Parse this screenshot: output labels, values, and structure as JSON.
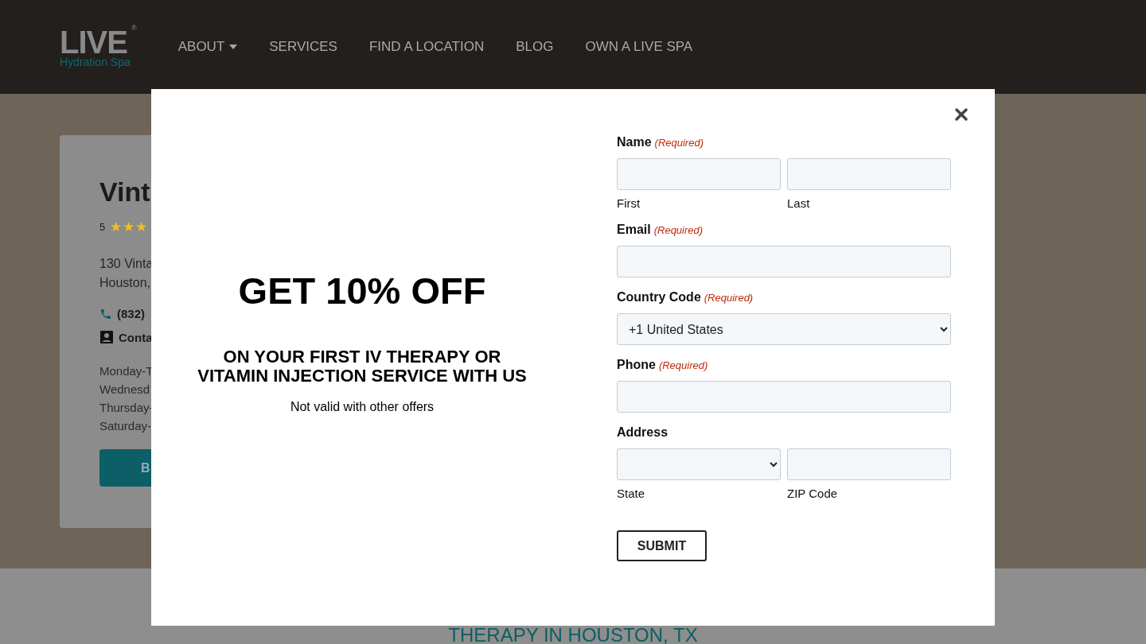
{
  "header": {
    "logo": {
      "word": "LIVE",
      "mark": "®",
      "sub": "Hydration Spa"
    },
    "nav": [
      {
        "label": "ABOUT",
        "dropdown": true
      },
      {
        "label": "SERVICES",
        "dropdown": false
      },
      {
        "label": "FIND A LOCATION",
        "dropdown": false
      },
      {
        "label": "BLOG",
        "dropdown": false
      },
      {
        "label": "OWN A LIVE SPA",
        "dropdown": false
      }
    ]
  },
  "location_card": {
    "title": "Vint",
    "rating": "5",
    "stars": 3,
    "address": [
      "130 Vinta",
      "Houston,"
    ],
    "phone": "(832)",
    "contact": "Conta",
    "hours": [
      "Monday-T",
      "Wednesd",
      "Thursday-",
      "Saturday-"
    ],
    "button": "B"
  },
  "section_heading": "THERAPY IN HOUSTON, TX",
  "modal": {
    "promo": {
      "headline": "GET 10% OFF",
      "subhead": "ON YOUR FIRST IV THERAPY OR VITAMIN INJECTION SERVICE WITH US",
      "note": "Not valid with other offers"
    },
    "form": {
      "fields": [
        {
          "label": "Name",
          "required_note": "(Required)",
          "parts": [
            {
              "kind": "input",
              "sublabel": "First"
            },
            {
              "kind": "input",
              "sublabel": "Last"
            }
          ]
        },
        {
          "label": "Email",
          "required_note": "(Required)",
          "parts": [
            {
              "kind": "input"
            }
          ]
        },
        {
          "label": "Country Code",
          "required_note": "(Required)",
          "parts": [
            {
              "kind": "select",
              "value": "+1 United States"
            }
          ]
        },
        {
          "label": "Phone",
          "required_note": "(Required)",
          "parts": [
            {
              "kind": "input"
            }
          ]
        },
        {
          "label": "Address",
          "parts": [
            {
              "kind": "select",
              "sublabel": "State"
            },
            {
              "kind": "input",
              "sublabel": "ZIP Code"
            }
          ]
        }
      ],
      "submit": "SUBMIT"
    }
  }
}
